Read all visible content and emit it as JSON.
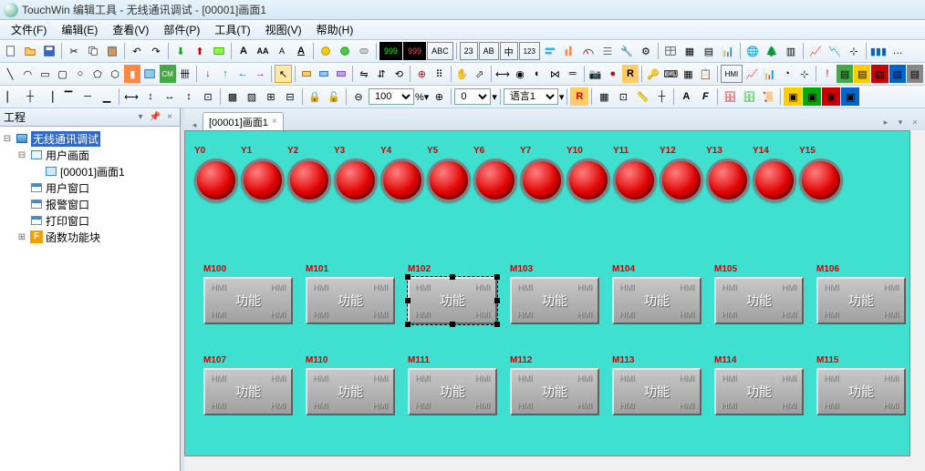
{
  "title": "TouchWin 编辑工具 - 无线通讯调试 - [00001]画面1",
  "menu": [
    "文件(F)",
    "编辑(E)",
    "查看(V)",
    "部件(P)",
    "工具(T)",
    "视图(V)",
    "帮助(H)"
  ],
  "panel_title": "工程",
  "tree": {
    "root": "无线通讯调试",
    "n1": "用户画面",
    "n1_1": "[00001]画面1",
    "n2": "用户窗口",
    "n3": "报警窗口",
    "n4": "打印窗口",
    "n5": "函数功能块"
  },
  "tab": "[00001]画面1",
  "zoom": "100",
  "spin": "0",
  "lang": "语言1",
  "lamps": [
    "Y0",
    "Y1",
    "Y2",
    "Y3",
    "Y4",
    "Y5",
    "Y6",
    "Y7",
    "Y10",
    "Y11",
    "Y12",
    "Y13",
    "Y14",
    "Y15"
  ],
  "row1": [
    "M100",
    "M101",
    "M102",
    "M103",
    "M104",
    "M105",
    "M106"
  ],
  "row2": [
    "M107",
    "M110",
    "M111",
    "M112",
    "M113",
    "M114",
    "M115"
  ],
  "btn_text": "功能",
  "selected_btn": "M102"
}
